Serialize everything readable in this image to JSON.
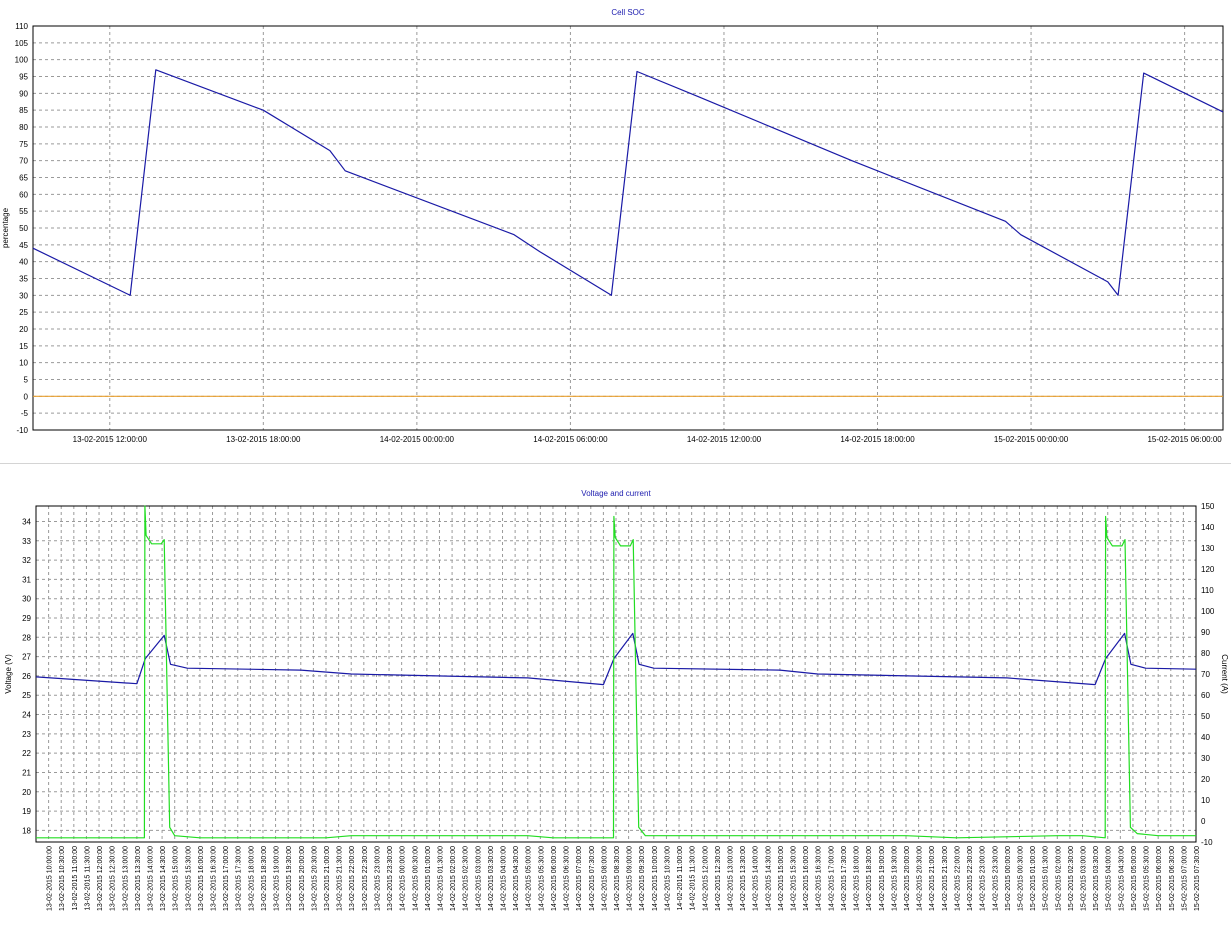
{
  "chart_data": [
    {
      "type": "line",
      "title": "Cell SOC",
      "ylabel": "percentage",
      "xlabel": "",
      "ylim": [
        -10,
        110
      ],
      "yticks": [
        -10,
        -5,
        0,
        5,
        10,
        15,
        20,
        25,
        30,
        35,
        40,
        45,
        50,
        55,
        60,
        65,
        70,
        75,
        80,
        85,
        90,
        95,
        100,
        105,
        110
      ],
      "xlim": [
        "13-02-2015 09:00:00",
        "15-02-2015 07:30:00"
      ],
      "xticks": [
        "13-02-2015 12:00:00",
        "13-02-2015 18:00:00",
        "14-02-2015 00:00:00",
        "14-02-2015 06:00:00",
        "14-02-2015 12:00:00",
        "14-02-2015 18:00:00",
        "15-02-2015 00:00:00",
        "15-02-2015 06:00:00"
      ],
      "grid": true,
      "series": [
        {
          "color": "#1a1aa6",
          "x": [
            "13-02-2015 09:00:00",
            "13-02-2015 12:48:00",
            "13-02-2015 13:48:00",
            "13-02-2015 18:00:00",
            "13-02-2015 20:36:00",
            "13-02-2015 21:12:00",
            "14-02-2015 03:48:00",
            "14-02-2015 04:48:00",
            "14-02-2015 07:36:00",
            "14-02-2015 08:36:00",
            "14-02-2015 11:00:00",
            "14-02-2015 17:00:00",
            "14-02-2015 23:00:00",
            "14-02-2015 23:36:00",
            "15-02-2015 03:00:00",
            "15-02-2015 03:24:00",
            "15-02-2015 04:24:00",
            "15-02-2015 07:30:00"
          ],
          "values": [
            44,
            30,
            97,
            85,
            73,
            67,
            48,
            43,
            30,
            96.5,
            89,
            70,
            52,
            48,
            34,
            30,
            96,
            84.5
          ]
        },
        {
          "color": "#e8a030",
          "x": [
            "13-02-2015 09:00:00",
            "15-02-2015 07:30:00"
          ],
          "values": [
            0,
            0
          ]
        }
      ]
    },
    {
      "type": "line",
      "title": "Voltage and current",
      "ylabel": "Voltage (V)",
      "y2label": "Current (A)",
      "ylim": [
        17.4,
        34.8
      ],
      "yticks": [
        18,
        19,
        20,
        21,
        22,
        23,
        24,
        25,
        26,
        27,
        28,
        29,
        30,
        31,
        32,
        33,
        34
      ],
      "y2lim": [
        -10,
        150
      ],
      "y2ticks": [
        -10,
        0,
        10,
        20,
        30,
        40,
        50,
        60,
        70,
        80,
        90,
        100,
        110,
        120,
        130,
        140,
        150
      ],
      "xlim": [
        "13-02-2015 09:30:00",
        "15-02-2015 07:30:00"
      ],
      "xticks": [
        "13-02-2015 10:00:00",
        "13-02-2015 10:30:00",
        "13-02-2015 11:00:00",
        "13-02-2015 11:30:00",
        "13-02-2015 12:00:00",
        "13-02-2015 12:30:00",
        "13-02-2015 13:00:00",
        "13-02-2015 13:30:00",
        "13-02-2015 14:00:00",
        "13-02-2015 14:30:00",
        "13-02-2015 15:00:00",
        "13-02-2015 15:30:00",
        "13-02-2015 16:00:00",
        "13-02-2015 16:30:00",
        "13-02-2015 17:00:00",
        "13-02-2015 17:30:00",
        "13-02-2015 18:00:00",
        "13-02-2015 18:30:00",
        "13-02-2015 19:00:00",
        "13-02-2015 19:30:00",
        "13-02-2015 20:00:00",
        "13-02-2015 20:30:00",
        "13-02-2015 21:00:00",
        "13-02-2015 21:30:00",
        "13-02-2015 22:00:00",
        "13-02-2015 22:30:00",
        "13-02-2015 23:00:00",
        "13-02-2015 23:30:00",
        "14-02-2015 00:00:00",
        "14-02-2015 00:30:00",
        "14-02-2015 01:00:00",
        "14-02-2015 01:30:00",
        "14-02-2015 02:00:00",
        "14-02-2015 02:30:00",
        "14-02-2015 03:00:00",
        "14-02-2015 03:30:00",
        "14-02-2015 04:00:00",
        "14-02-2015 04:30:00",
        "14-02-2015 05:00:00",
        "14-02-2015 05:30:00",
        "14-02-2015 06:00:00",
        "14-02-2015 06:30:00",
        "14-02-2015 07:00:00",
        "14-02-2015 07:30:00",
        "14-02-2015 08:00:00",
        "14-02-2015 08:30:00",
        "14-02-2015 09:00:00",
        "14-02-2015 09:30:00",
        "14-02-2015 10:00:00",
        "14-02-2015 10:30:00",
        "14-02-2015 11:00:00",
        "14-02-2015 11:30:00",
        "14-02-2015 12:00:00",
        "14-02-2015 12:30:00",
        "14-02-2015 13:00:00",
        "14-02-2015 13:30:00",
        "14-02-2015 14:00:00",
        "14-02-2015 14:30:00",
        "14-02-2015 15:00:00",
        "14-02-2015 15:30:00",
        "14-02-2015 16:00:00",
        "14-02-2015 16:30:00",
        "14-02-2015 17:00:00",
        "14-02-2015 17:30:00",
        "14-02-2015 18:00:00",
        "14-02-2015 18:30:00",
        "14-02-2015 19:00:00",
        "14-02-2015 19:30:00",
        "14-02-2015 20:00:00",
        "14-02-2015 20:30:00",
        "14-02-2015 21:00:00",
        "14-02-2015 21:30:00",
        "14-02-2015 22:00:00",
        "14-02-2015 22:30:00",
        "14-02-2015 23:00:00",
        "14-02-2015 23:30:00",
        "15-02-2015 00:00:00",
        "15-02-2015 00:30:00",
        "15-02-2015 01:00:00",
        "15-02-2015 01:30:00",
        "15-02-2015 02:00:00",
        "15-02-2015 02:30:00",
        "15-02-2015 03:00:00",
        "15-02-2015 03:30:00",
        "15-02-2015 04:00:00",
        "15-02-2015 04:30:00",
        "15-02-2015 05:00:00",
        "15-02-2015 05:30:00",
        "15-02-2015 06:00:00",
        "15-02-2015 06:30:00",
        "15-02-2015 07:00:00",
        "15-02-2015 07:30:00"
      ],
      "grid": true,
      "series": [
        {
          "axis": "left",
          "color": "#1a1aa6",
          "x": [
            "13-02-2015 09:30:00",
            "13-02-2015 13:30:00",
            "13-02-2015 13:50:00",
            "13-02-2015 14:35:00",
            "13-02-2015 14:50:00",
            "13-02-2015 15:30:00",
            "13-02-2015 20:00:00",
            "13-02-2015 22:00:00",
            "14-02-2015 05:00:00",
            "14-02-2015 08:00:00",
            "14-02-2015 08:25:00",
            "14-02-2015 09:10:00",
            "14-02-2015 09:25:00",
            "14-02-2015 10:00:00",
            "14-02-2015 15:00:00",
            "14-02-2015 16:30:00",
            "15-02-2015 00:00:00",
            "15-02-2015 03:30:00",
            "15-02-2015 03:55:00",
            "15-02-2015 04:40:00",
            "15-02-2015 04:55:00",
            "15-02-2015 05:30:00",
            "15-02-2015 07:30:00"
          ],
          "values": [
            25.95,
            25.6,
            26.9,
            28.1,
            26.6,
            26.4,
            26.3,
            26.1,
            25.9,
            25.55,
            26.9,
            28.2,
            26.6,
            26.4,
            26.3,
            26.1,
            25.9,
            25.55,
            26.9,
            28.2,
            26.6,
            26.4,
            26.35
          ]
        },
        {
          "axis": "right",
          "color": "#22dd22",
          "x": [
            "13-02-2015 09:30:00",
            "13-02-2015 13:48:00",
            "13-02-2015 13:49:00",
            "13-02-2015 13:52:00",
            "13-02-2015 14:05:00",
            "13-02-2015 14:28:00",
            "13-02-2015 14:35:00",
            "13-02-2015 14:48:00",
            "13-02-2015 15:00:00",
            "13-02-2015 16:00:00",
            "13-02-2015 21:00:00",
            "13-02-2015 22:00:00",
            "14-02-2015 05:00:00",
            "14-02-2015 06:00:00",
            "14-02-2015 08:24:00",
            "14-02-2015 08:25:00",
            "14-02-2015 08:28:00",
            "14-02-2015 08:41:00",
            "14-02-2015 09:04:00",
            "14-02-2015 09:11:00",
            "14-02-2015 09:24:00",
            "14-02-2015 09:40:00",
            "14-02-2015 11:00:00",
            "14-02-2015 16:00:00",
            "14-02-2015 20:00:00",
            "14-02-2015 22:00:00",
            "15-02-2015 02:00:00",
            "15-02-2015 03:00:00",
            "15-02-2015 03:54:00",
            "15-02-2015 03:55:00",
            "15-02-2015 03:58:00",
            "15-02-2015 04:11:00",
            "15-02-2015 04:34:00",
            "15-02-2015 04:41:00",
            "15-02-2015 04:54:00",
            "15-02-2015 05:10:00",
            "15-02-2015 06:00:00",
            "15-02-2015 07:30:00"
          ],
          "values": [
            -8,
            -8,
            150,
            136,
            132,
            132,
            134,
            -3,
            -7,
            -8,
            -8,
            -7,
            -7,
            -8,
            -8,
            145,
            135,
            131,
            131,
            134,
            -3,
            -7,
            -7,
            -7,
            -7,
            -8,
            -7,
            -7,
            -8,
            145,
            135,
            131,
            131,
            134,
            -3,
            -6,
            -7,
            -7
          ]
        }
      ]
    }
  ]
}
